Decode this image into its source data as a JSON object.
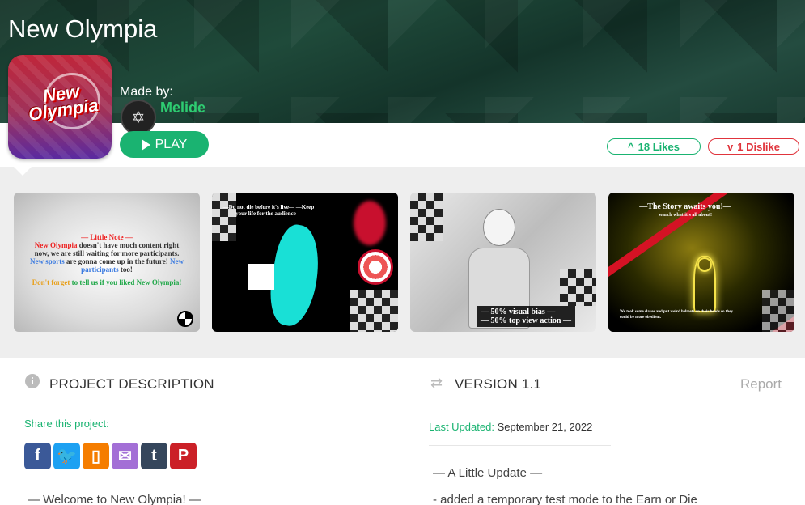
{
  "project": {
    "title": "New Olympia",
    "logo_text": "New Olympia",
    "made_by_label": "Made by:",
    "creator": "Melide"
  },
  "actions": {
    "play_label": "PLAY",
    "likes_label": "18 Likes",
    "dislikes_label": "1 Dislike"
  },
  "gallery": {
    "thumb1": {
      "note_title": "— Little Note —",
      "line1_red": "New Olympia",
      "line1_rest": " doesn't have much content right now, we are still waiting for more participants. ",
      "line1_blue": "New sports",
      "line1_mid": " are gonna come up in the future! ",
      "line1_blue2": "New participants",
      "line1_end": " too!",
      "line2_orange": "Don't forget",
      "line2_green": " to tell us if you liked New Olympia!"
    },
    "thumb2": {
      "caption": "—Do not die before it's live— —Keep your life for the audience—"
    },
    "thumb3": {
      "caption1": "— 50% visual bias —",
      "caption2": "— 50% top view action —"
    },
    "thumb4": {
      "caption_title": "—The Story awaits you!—",
      "caption_sub": "search what it's all about!",
      "bottom_text": "We took some slaves and put weird helmets on their heads so they could be more obedient."
    }
  },
  "description": {
    "title": "PROJECT DESCRIPTION",
    "share_label": "Share this project:",
    "share_buttons": [
      {
        "name": "facebook",
        "glyph": "f",
        "color": "#3b5998"
      },
      {
        "name": "twitter",
        "glyph": "t",
        "color": "#1da1f2"
      },
      {
        "name": "blogger",
        "glyph": "▯",
        "color": "#f57d00"
      },
      {
        "name": "email",
        "glyph": "✉",
        "color": "#a36fd6"
      },
      {
        "name": "tumblr",
        "glyph": "t",
        "color": "#35465c"
      },
      {
        "name": "pinterest",
        "glyph": "P",
        "color": "#cb2027"
      }
    ],
    "welcome": "— Welcome to New Olympia! —"
  },
  "version": {
    "title": "VERSION 1.1",
    "report_label": "Report",
    "last_updated_label": "Last Updated:",
    "last_updated_value": "September 21, 2022",
    "heading": "— A Little Update —",
    "changelog_line": "- added a temporary test mode to the Earn or Die"
  },
  "colors": {
    "accent_green": "#1ab371",
    "dislike_red": "#e0343c"
  }
}
